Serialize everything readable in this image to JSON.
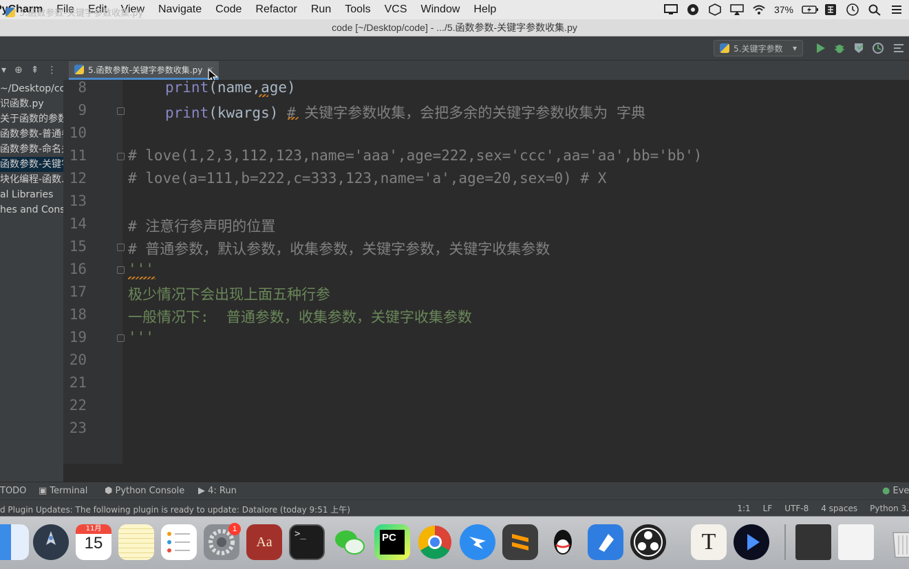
{
  "menubar": {
    "app_name": "PyCharm",
    "items": [
      "File",
      "Edit",
      "View",
      "Navigate",
      "Code",
      "Refactor",
      "Run",
      "Tools",
      "VCS",
      "Window",
      "Help"
    ],
    "battery": "37%"
  },
  "window": {
    "title": "code [~/Desktop/code] - .../5.函数参数-关键字参数收集.py"
  },
  "navbar": {
    "file": "5.函数参数-关键字参数收集.py",
    "run_config": "5.关键字参数"
  },
  "sidebar": {
    "items": [
      {
        "label": "~/Desktop/co",
        "selected": false
      },
      {
        "label": "识函数.py",
        "selected": false
      },
      {
        "label": "关于函数的参数",
        "selected": false
      },
      {
        "label": "函数参数-普通参",
        "selected": false
      },
      {
        "label": "函数参数-命名关",
        "selected": false
      },
      {
        "label": "函数参数-关键字",
        "selected": true
      },
      {
        "label": "块化编程-函数.",
        "selected": false
      },
      {
        "label": "al Libraries",
        "selected": false
      },
      {
        "label": "hes and Cons",
        "selected": false
      }
    ]
  },
  "editor": {
    "tab": "5.函数参数-关键字参数收集.py",
    "line_numbers": [
      "8",
      "9",
      "10",
      "11",
      "12",
      "13",
      "14",
      "15",
      "16",
      "17",
      "18",
      "19",
      "20",
      "21",
      "22",
      "23"
    ],
    "line8": {
      "kw": "print",
      "rest": "(name,age)"
    },
    "line9": {
      "kw": "print",
      "rest": "(kwargs) ",
      "comment": "# 关键字参数收集，会把多余的关键字参数收集为 字典"
    },
    "line11": "# love(1,2,3,112,123,name='aaa',age=222,sex='ccc',aa='aa',bb='bb')",
    "line12": "# love(a=111,b=222,c=333,123,name='a',age=20,sex=0) # X",
    "line14": "# 注意行参声明的位置",
    "line15": "# 普通参数，默认参数，收集参数，关键字参数，关键字收集参数",
    "line16": "'''",
    "line17": "极少情况下会出现上面五种行参",
    "line18": "一般情况下:  普通参数，收集参数，关键字收集参数",
    "line19": "'''"
  },
  "tool_windows": {
    "todo": "TODO",
    "terminal": "Terminal",
    "python_console": "Python Console",
    "run": "4: Run",
    "event_log": "Eve"
  },
  "statusbar": {
    "message": "d Plugin Updates: The following plugin is ready to update: Datalore (today 9:51 上午)",
    "position": "1:1",
    "line_sep": "LF",
    "encoding": "UTF-8",
    "indent": "4 spaces",
    "interpreter": "Python 3."
  },
  "dock": {
    "calendar_month": "11月",
    "calendar_day": "15",
    "prefs_badge": "1",
    "textedit_letter": "T",
    "dictionary_label": "Aa",
    "pycharm_label": "PC"
  },
  "colors": {
    "editor_bg": "#2b2b2b",
    "keyword": "#8888c6",
    "comment": "#808080",
    "docstring": "#6a8759",
    "tab_underline": "#4a88c7"
  }
}
